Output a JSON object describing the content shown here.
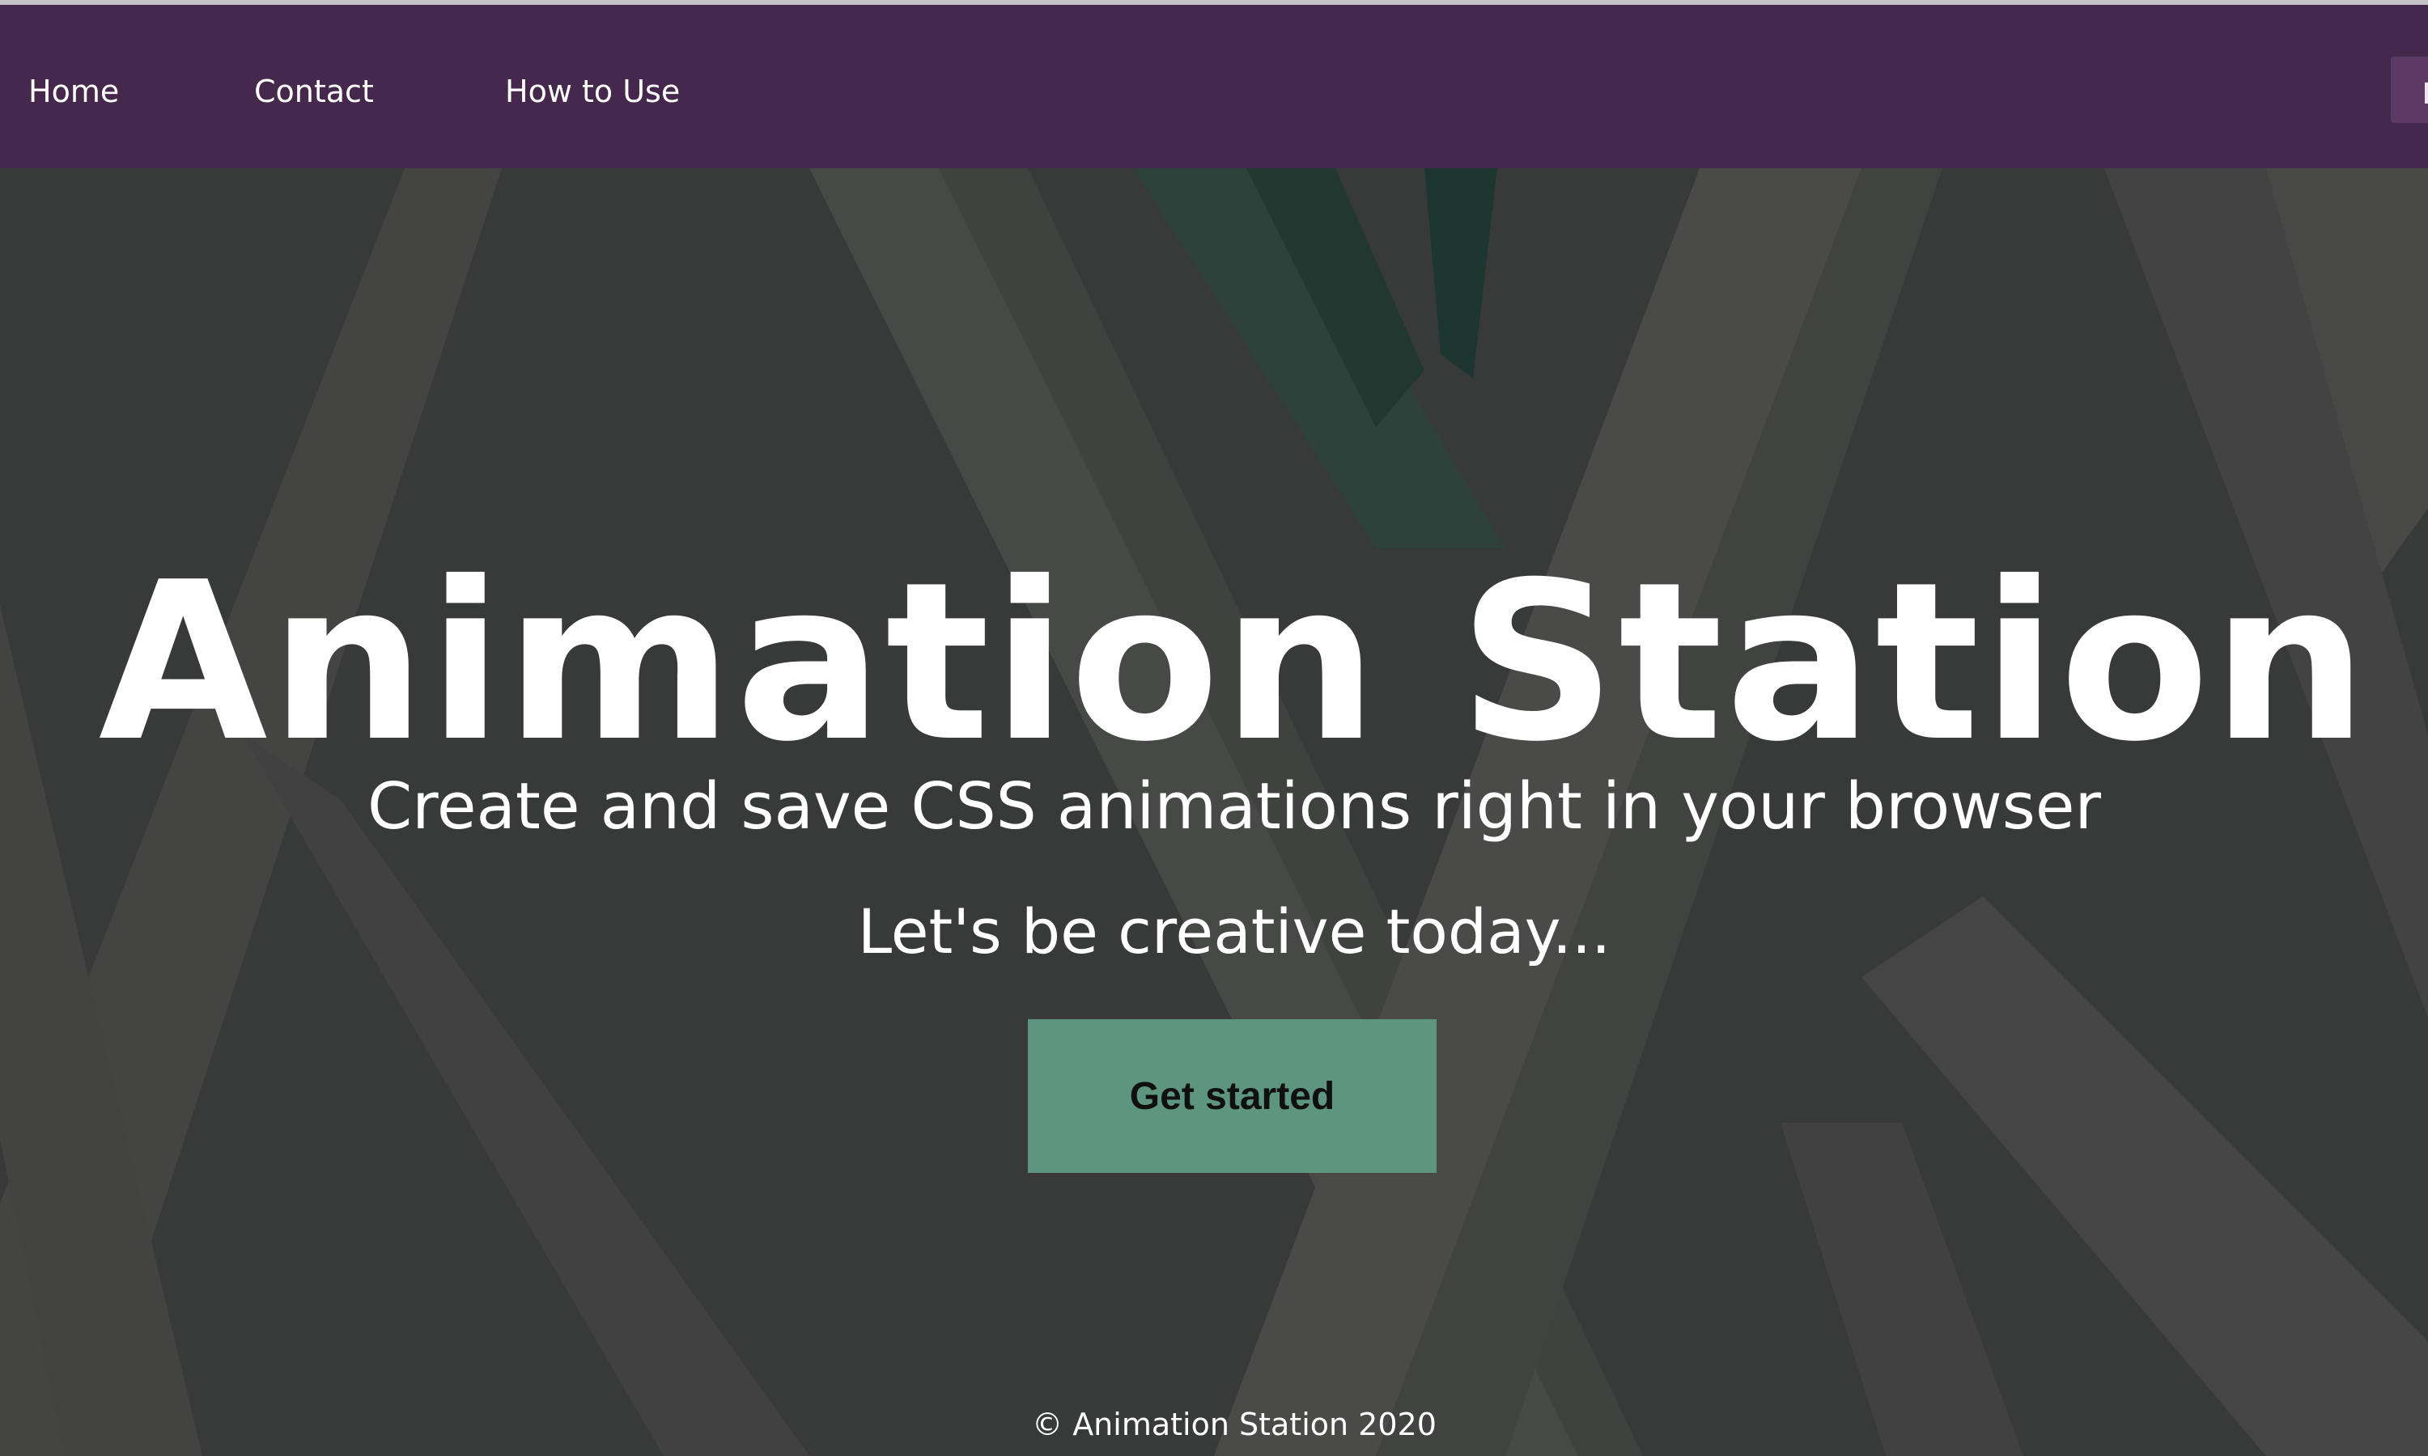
{
  "nav": {
    "items": [
      {
        "label": "Home"
      },
      {
        "label": "Contact"
      },
      {
        "label": "How to Use"
      }
    ]
  },
  "hero": {
    "title": "Animation Station",
    "subtitle": "Create and save CSS animations right in your browser",
    "tagline": "Let's be creative today...",
    "cta_label": "Get started"
  },
  "footer": {
    "copyright": "© Animation Station 2020"
  },
  "colors": {
    "navbar": "#45284b",
    "hero_overlay": "#3e403f",
    "cta": "#5e9580",
    "text": "#ffffff"
  }
}
